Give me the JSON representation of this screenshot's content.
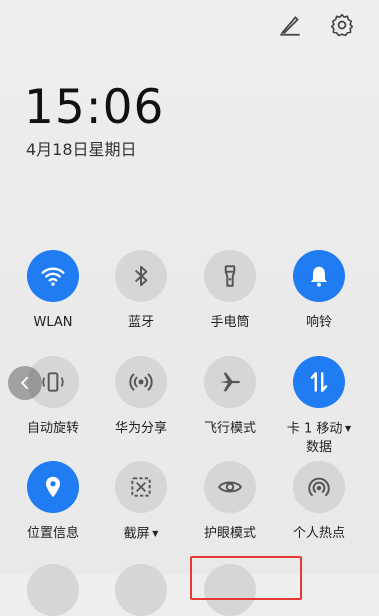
{
  "time": "15:06",
  "date": "4月18日星期日",
  "tiles": [
    {
      "label": "WLAN",
      "icon": "wifi-icon",
      "active": true
    },
    {
      "label": "蓝牙",
      "icon": "bluetooth-icon",
      "active": false
    },
    {
      "label": "手电筒",
      "icon": "flashlight-icon",
      "active": false
    },
    {
      "label": "响铃",
      "icon": "bell-icon",
      "active": true
    },
    {
      "label": "自动旋转",
      "icon": "auto-rotate-icon",
      "active": false
    },
    {
      "label": "华为分享",
      "icon": "share-icon",
      "active": false
    },
    {
      "label": "飞行模式",
      "icon": "airplane-icon",
      "active": false
    },
    {
      "label": "卡 1 移动",
      "label2": "数据",
      "icon": "mobile-data-icon",
      "active": true
    },
    {
      "label": "位置信息",
      "icon": "location-icon",
      "active": true
    },
    {
      "label": "截屏",
      "icon": "screenshot-icon",
      "active": false
    },
    {
      "label": "护眼模式",
      "icon": "eye-icon",
      "active": false
    },
    {
      "label": "个人热点",
      "icon": "hotspot-icon",
      "active": false
    }
  ],
  "colors": {
    "active": "#1f7cf3",
    "inactive": "#d6d6d6",
    "highlight": "#e53935"
  }
}
